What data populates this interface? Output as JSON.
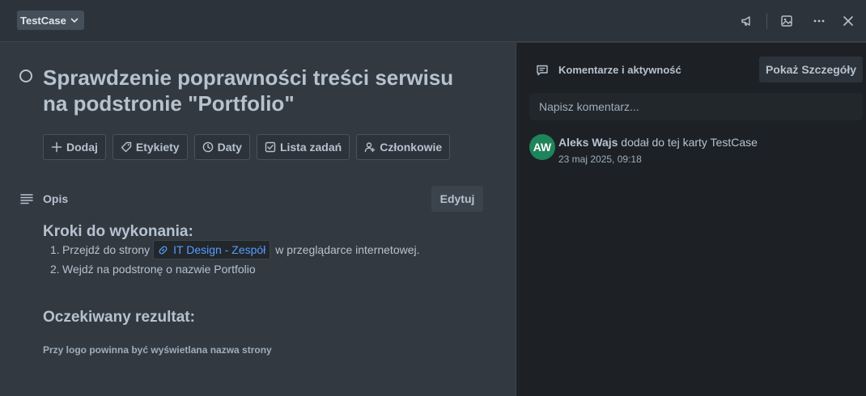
{
  "header": {
    "list_name": "TestCase",
    "icons": [
      "megaphone-icon",
      "image-icon",
      "more-icon",
      "close-icon"
    ]
  },
  "card": {
    "title": "Sprawdzenie poprawności treści serwisu na podstronie \"Portfolio\"",
    "actions": [
      {
        "label": "Dodaj",
        "icon": "plus-icon"
      },
      {
        "label": "Etykiety",
        "icon": "tag-icon"
      },
      {
        "label": "Daty",
        "icon": "clock-icon"
      },
      {
        "label": "Lista zadań",
        "icon": "checklist-icon"
      },
      {
        "label": "Członkowie",
        "icon": "user-add-icon"
      }
    ]
  },
  "description": {
    "label": "Opis",
    "edit_label": "Edytuj",
    "steps_heading": "Kroki do wykonania:",
    "steps": [
      {
        "num": "1.",
        "before": "Przejdź do strony",
        "link": "IT Design - Zespół",
        "after": "w przeglądarce internetowej."
      },
      {
        "num": "2.",
        "text": "Wejdź na podstronę o nazwie Portfolio"
      }
    ],
    "result_heading": "Oczekiwany rezultat:",
    "result_text": "Przy logo powinna być wyświetlana nazwa strony"
  },
  "activity": {
    "title": "Komentarze i aktywność",
    "details_label": "Pokaż Szczegóły",
    "comment_placeholder": "Napisz komentarz...",
    "entries": [
      {
        "initials": "AW",
        "user": "Aleks Wajs",
        "text": "dodał do tej karty TestCase",
        "time": "23 maj 2025, 09:18",
        "avatar_color": "#1f845a"
      }
    ]
  },
  "colors": {
    "link": "#579dff",
    "background": "#323940",
    "sidebar": "#1d2125"
  }
}
